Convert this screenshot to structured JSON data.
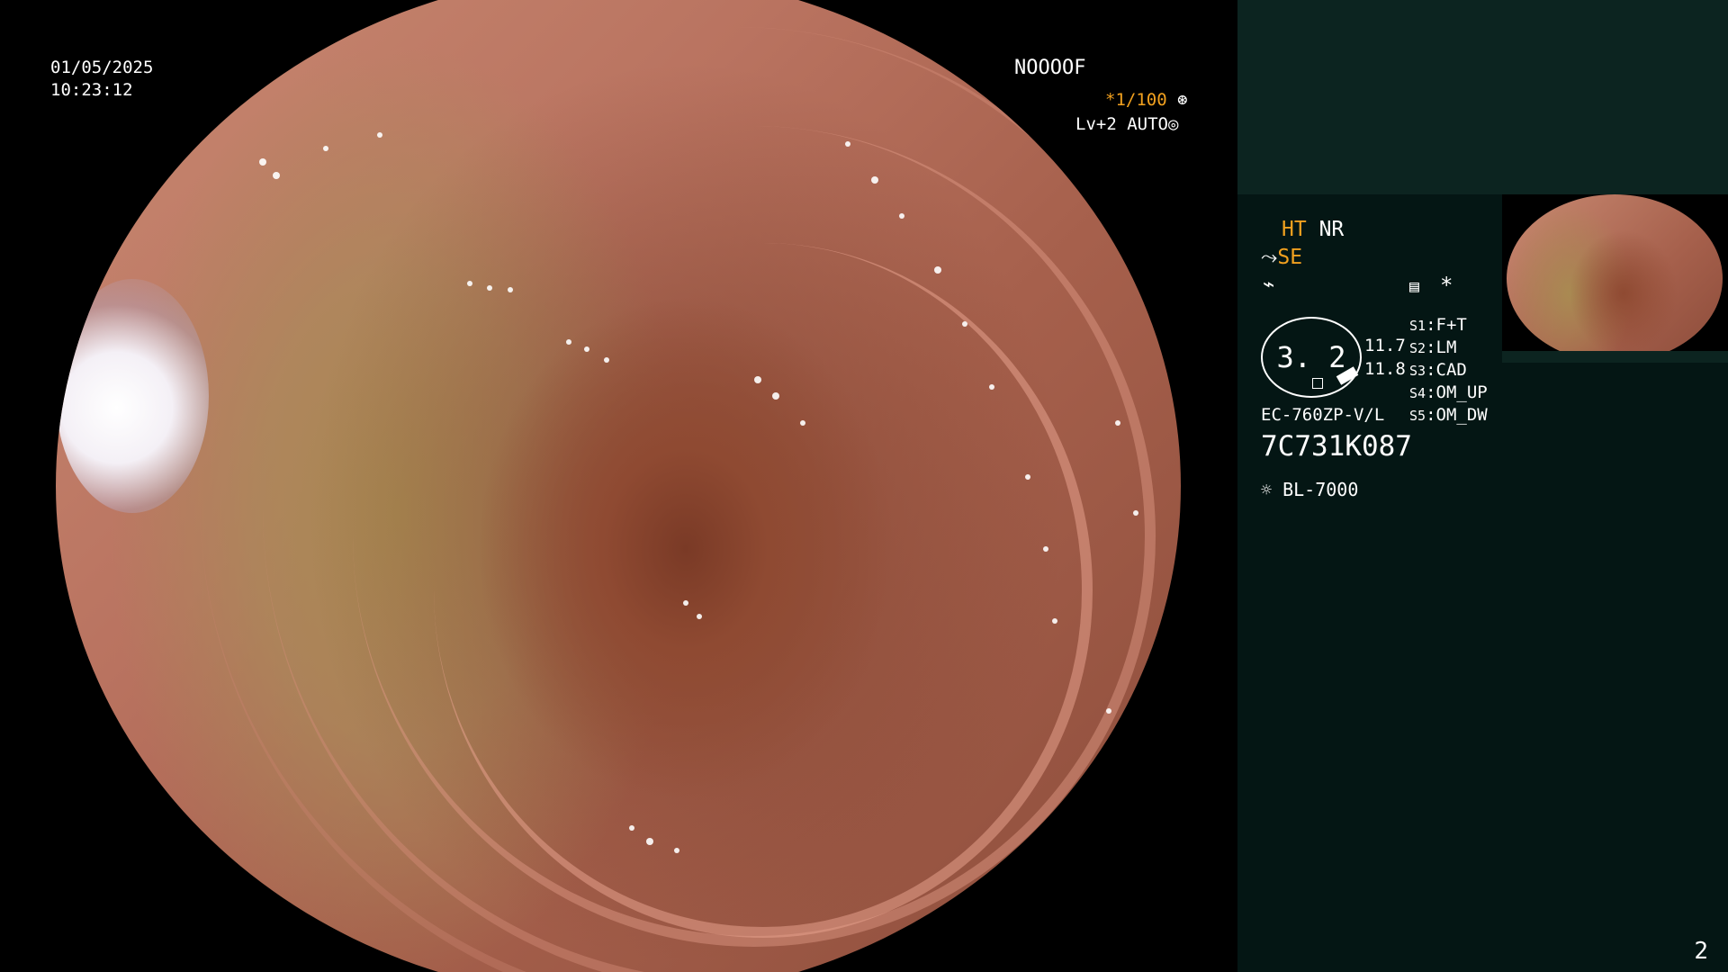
{
  "video": {
    "date": "01/05/2025",
    "time": "10:23:12",
    "mode_code": "NOOOOF",
    "shutter": "*1/100",
    "shutter_icon": "aperture-icon",
    "level": "Lv+2",
    "iris": "AUTO",
    "iris_icon": "iris-icon"
  },
  "panel": {
    "ht": "HT",
    "nr": "NR",
    "se": "SE",
    "se_icon": "structure-enhancement-icon",
    "lightning_icon": "lightning-icon",
    "memo_icon": "memo-icon",
    "asterisk": "*",
    "dial_value": "3. 2",
    "value_top": "11.7",
    "value_bottom": "11.8",
    "scope_model": "EC-760ZP-V/L",
    "serial": "7C731K087",
    "light_icon": "light-source-icon",
    "light_source": "BL-7000",
    "switches": [
      {
        "key": "S1",
        "value": "F+T"
      },
      {
        "key": "S2",
        "value": "LM"
      },
      {
        "key": "S3",
        "value": "CAD"
      },
      {
        "key": "S4",
        "value": "OM_UP"
      },
      {
        "key": "S5",
        "value": "OM_DW"
      }
    ]
  },
  "page_number": "2",
  "colors": {
    "accent": "#f2a11f",
    "panel_bg": "#041614",
    "panel_top_bg": "#0c2420"
  }
}
